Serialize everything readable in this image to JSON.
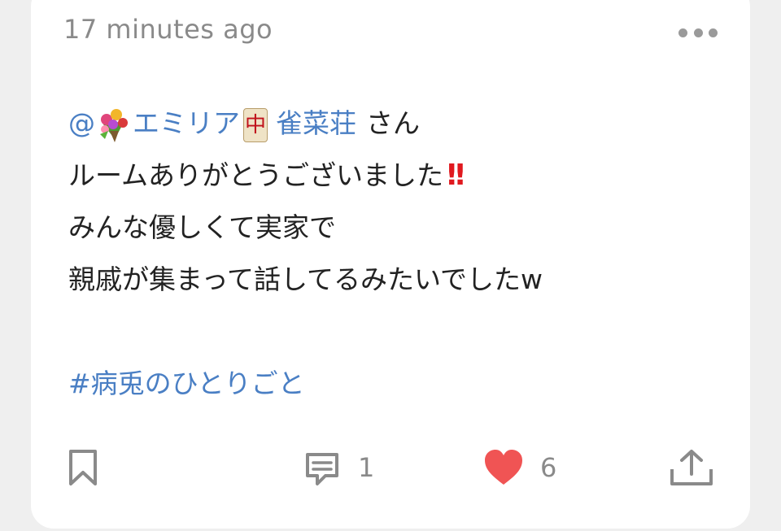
{
  "post": {
    "timestamp": "17 minutes ago",
    "mention": {
      "at": "@",
      "name": "エミリア",
      "tile_glyph": "中",
      "name2": "雀菜荘",
      "suffix": "さん"
    },
    "lines": [
      "ルームありがとうございました",
      "みんな優しくて実家で",
      "親戚が集まって話してるみたいでしたw"
    ],
    "exclamation": "!!",
    "hashtag": "#病兎のひとりごと"
  },
  "actions": {
    "comment_count": "1",
    "like_count": "6"
  },
  "icons": {
    "more": "more-horizontal-icon",
    "bookmark": "bookmark-icon",
    "comment": "comment-icon",
    "like": "heart-icon",
    "share": "share-icon",
    "bouquet": "bouquet-emoji-icon",
    "tile": "mahjong-red-dragon-icon"
  },
  "colors": {
    "link": "#4a7fc4",
    "heart": "#f05454",
    "muted": "#8a8a8a",
    "exclamation": "#e0191f"
  }
}
